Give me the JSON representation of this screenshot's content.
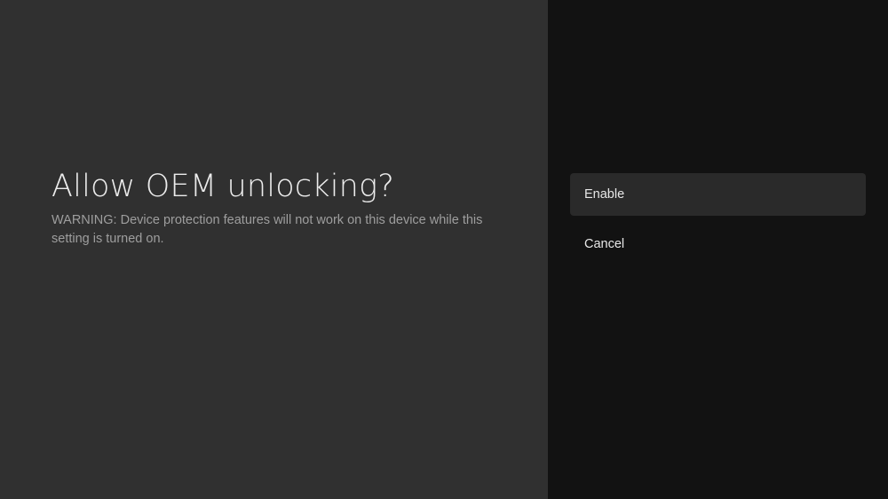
{
  "dialog": {
    "title": "Allow OEM unlocking?",
    "message": "WARNING: Device protection features will not work on this device while this setting is turned on."
  },
  "actions": {
    "items": [
      {
        "label": "Enable",
        "focused": true
      },
      {
        "label": "Cancel",
        "focused": false
      }
    ]
  },
  "colors": {
    "left_pane": "#303030",
    "right_pane": "#121212",
    "focused_item": "#2a2a2a",
    "title_text": "#ececec",
    "message_text": "#9e9e9e"
  }
}
